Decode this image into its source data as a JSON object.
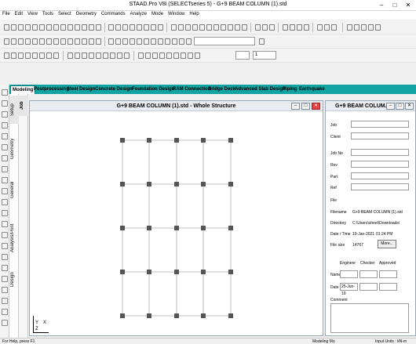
{
  "window": {
    "title": "STAAD.Pro V8i (SELECTseries 5) - G+9 BEAM COLUMN (1).std",
    "minimize": "–",
    "maximize": "□",
    "close": "✕"
  },
  "menu": [
    "File",
    "Edit",
    "View",
    "Tools",
    "Select",
    "Geometry",
    "Commands",
    "Analyze",
    "Mode",
    "Window",
    "Help"
  ],
  "toolbar": {
    "combo_sample_value": "1"
  },
  "mode_tabs": [
    {
      "label": "Modeling",
      "active": true
    },
    {
      "label": "Postprocessing",
      "active": false
    },
    {
      "label": "Steel Design",
      "active": false
    },
    {
      "label": "Concrete Design",
      "active": false
    },
    {
      "label": "Foundation Design",
      "active": false
    },
    {
      "label": "RAM Connection",
      "active": false
    },
    {
      "label": "Bridge Deck",
      "active": false
    },
    {
      "label": "Advanced Slab Design",
      "active": false
    },
    {
      "label": "Piping",
      "active": false
    },
    {
      "label": "Earthquake",
      "active": false
    }
  ],
  "page_control": {
    "groups": [
      "Setup",
      "Geometry",
      "General",
      "Analysis/Print",
      "Design"
    ],
    "subtab": "Job"
  },
  "structure_window": {
    "title": "G+9 BEAM COLUMN (1).std - Whole Structure",
    "axis_x": "X",
    "axis_y": "Y",
    "axis_z": "Z"
  },
  "job_info": {
    "panel_title": "G+9 BEAM COLUM...",
    "labels": {
      "job": "Job",
      "client": "Client",
      "job_no": "Job No",
      "rev": "Rev",
      "part": "Part",
      "ref": "Ref",
      "file_section": "File",
      "filename": "Filename",
      "directory": "Directory",
      "date_time": "Date / Time",
      "file_size": "File size",
      "engineer": "Engineer",
      "checker": "Checker",
      "approved": "Approved",
      "name": "Name",
      "date": "Date",
      "comment": "Comment"
    },
    "values": {
      "filename": "G+9 BEAM COLUMN (1).std",
      "directory": "C:\\Users\\sheel\\Downloads\\",
      "date": "19-Jan-2021",
      "time": "01:24 PM",
      "file_size": "14767",
      "engineer_date": "25-Jun-19"
    },
    "more_button": "More..."
  },
  "status": {
    "left": "For Help, press F1",
    "middle": "Modeling Mo",
    "right": "Input Units : kN-m"
  }
}
